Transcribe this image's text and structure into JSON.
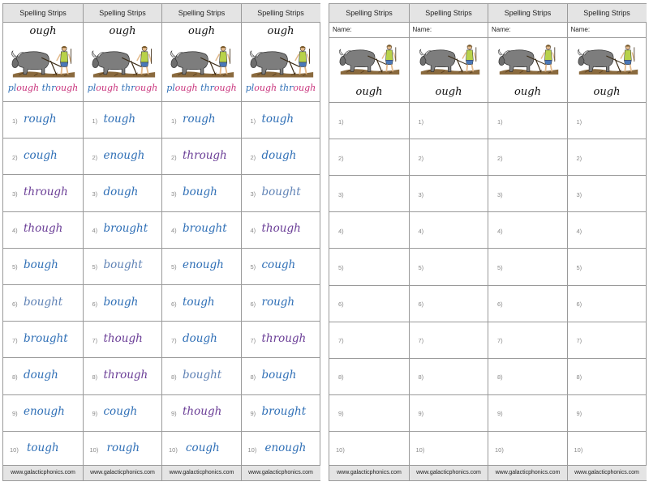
{
  "header_label": "Spelling Strips",
  "footer_label": "www.galacticphonics.com",
  "sound": "ough",
  "keywords": {
    "plough_pre": "pl",
    "plough_post": "ough",
    "through_pre": "thr",
    "through_post": "ough"
  },
  "name_label": "Name:",
  "numbers": [
    "1)",
    "2)",
    "3)",
    "4)",
    "5)",
    "6)",
    "7)",
    "8)",
    "9)",
    "10)"
  ],
  "colors": {
    "blue": "#2f6fb6",
    "purple": "#6a3d96",
    "pink": "#c8327b",
    "header_bg": "#e4e4e4"
  },
  "picture_icon": "ox-plough-farmer-icon",
  "strips": [
    [
      "rough",
      "cough",
      "through",
      "though",
      "bough",
      "bought",
      "brought",
      "dough",
      "enough",
      "tough"
    ],
    [
      "tough",
      "enough",
      "dough",
      "brought",
      "bought",
      "bough",
      "though",
      "through",
      "cough",
      "rough"
    ],
    [
      "rough",
      "through",
      "bough",
      "brought",
      "enough",
      "tough",
      "dough",
      "bought",
      "though",
      "cough"
    ],
    [
      "tough",
      "dough",
      "bought",
      "though",
      "cough",
      "rough",
      "through",
      "bough",
      "brought",
      "enough"
    ]
  ]
}
